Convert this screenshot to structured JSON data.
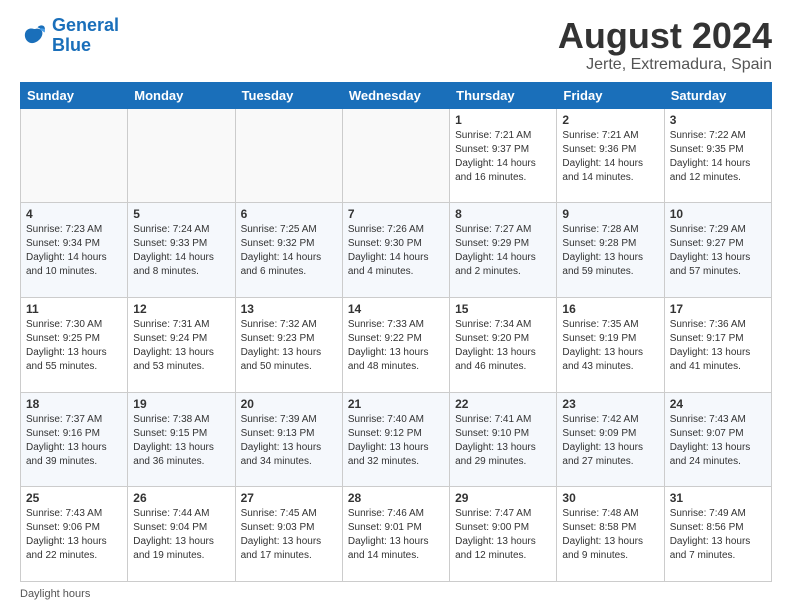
{
  "logo": {
    "line1": "General",
    "line2": "Blue"
  },
  "title": "August 2024",
  "subtitle": "Jerte, Extremadura, Spain",
  "days_of_week": [
    "Sunday",
    "Monday",
    "Tuesday",
    "Wednesday",
    "Thursday",
    "Friday",
    "Saturday"
  ],
  "footer": "Daylight hours",
  "weeks": [
    [
      {
        "day": "",
        "info": ""
      },
      {
        "day": "",
        "info": ""
      },
      {
        "day": "",
        "info": ""
      },
      {
        "day": "",
        "info": ""
      },
      {
        "day": "1",
        "info": "Sunrise: 7:21 AM\nSunset: 9:37 PM\nDaylight: 14 hours and 16 minutes."
      },
      {
        "day": "2",
        "info": "Sunrise: 7:21 AM\nSunset: 9:36 PM\nDaylight: 14 hours and 14 minutes."
      },
      {
        "day": "3",
        "info": "Sunrise: 7:22 AM\nSunset: 9:35 PM\nDaylight: 14 hours and 12 minutes."
      }
    ],
    [
      {
        "day": "4",
        "info": "Sunrise: 7:23 AM\nSunset: 9:34 PM\nDaylight: 14 hours and 10 minutes."
      },
      {
        "day": "5",
        "info": "Sunrise: 7:24 AM\nSunset: 9:33 PM\nDaylight: 14 hours and 8 minutes."
      },
      {
        "day": "6",
        "info": "Sunrise: 7:25 AM\nSunset: 9:32 PM\nDaylight: 14 hours and 6 minutes."
      },
      {
        "day": "7",
        "info": "Sunrise: 7:26 AM\nSunset: 9:30 PM\nDaylight: 14 hours and 4 minutes."
      },
      {
        "day": "8",
        "info": "Sunrise: 7:27 AM\nSunset: 9:29 PM\nDaylight: 14 hours and 2 minutes."
      },
      {
        "day": "9",
        "info": "Sunrise: 7:28 AM\nSunset: 9:28 PM\nDaylight: 13 hours and 59 minutes."
      },
      {
        "day": "10",
        "info": "Sunrise: 7:29 AM\nSunset: 9:27 PM\nDaylight: 13 hours and 57 minutes."
      }
    ],
    [
      {
        "day": "11",
        "info": "Sunrise: 7:30 AM\nSunset: 9:25 PM\nDaylight: 13 hours and 55 minutes."
      },
      {
        "day": "12",
        "info": "Sunrise: 7:31 AM\nSunset: 9:24 PM\nDaylight: 13 hours and 53 minutes."
      },
      {
        "day": "13",
        "info": "Sunrise: 7:32 AM\nSunset: 9:23 PM\nDaylight: 13 hours and 50 minutes."
      },
      {
        "day": "14",
        "info": "Sunrise: 7:33 AM\nSunset: 9:22 PM\nDaylight: 13 hours and 48 minutes."
      },
      {
        "day": "15",
        "info": "Sunrise: 7:34 AM\nSunset: 9:20 PM\nDaylight: 13 hours and 46 minutes."
      },
      {
        "day": "16",
        "info": "Sunrise: 7:35 AM\nSunset: 9:19 PM\nDaylight: 13 hours and 43 minutes."
      },
      {
        "day": "17",
        "info": "Sunrise: 7:36 AM\nSunset: 9:17 PM\nDaylight: 13 hours and 41 minutes."
      }
    ],
    [
      {
        "day": "18",
        "info": "Sunrise: 7:37 AM\nSunset: 9:16 PM\nDaylight: 13 hours and 39 minutes."
      },
      {
        "day": "19",
        "info": "Sunrise: 7:38 AM\nSunset: 9:15 PM\nDaylight: 13 hours and 36 minutes."
      },
      {
        "day": "20",
        "info": "Sunrise: 7:39 AM\nSunset: 9:13 PM\nDaylight: 13 hours and 34 minutes."
      },
      {
        "day": "21",
        "info": "Sunrise: 7:40 AM\nSunset: 9:12 PM\nDaylight: 13 hours and 32 minutes."
      },
      {
        "day": "22",
        "info": "Sunrise: 7:41 AM\nSunset: 9:10 PM\nDaylight: 13 hours and 29 minutes."
      },
      {
        "day": "23",
        "info": "Sunrise: 7:42 AM\nSunset: 9:09 PM\nDaylight: 13 hours and 27 minutes."
      },
      {
        "day": "24",
        "info": "Sunrise: 7:43 AM\nSunset: 9:07 PM\nDaylight: 13 hours and 24 minutes."
      }
    ],
    [
      {
        "day": "25",
        "info": "Sunrise: 7:43 AM\nSunset: 9:06 PM\nDaylight: 13 hours and 22 minutes."
      },
      {
        "day": "26",
        "info": "Sunrise: 7:44 AM\nSunset: 9:04 PM\nDaylight: 13 hours and 19 minutes."
      },
      {
        "day": "27",
        "info": "Sunrise: 7:45 AM\nSunset: 9:03 PM\nDaylight: 13 hours and 17 minutes."
      },
      {
        "day": "28",
        "info": "Sunrise: 7:46 AM\nSunset: 9:01 PM\nDaylight: 13 hours and 14 minutes."
      },
      {
        "day": "29",
        "info": "Sunrise: 7:47 AM\nSunset: 9:00 PM\nDaylight: 13 hours and 12 minutes."
      },
      {
        "day": "30",
        "info": "Sunrise: 7:48 AM\nSunset: 8:58 PM\nDaylight: 13 hours and 9 minutes."
      },
      {
        "day": "31",
        "info": "Sunrise: 7:49 AM\nSunset: 8:56 PM\nDaylight: 13 hours and 7 minutes."
      }
    ]
  ]
}
